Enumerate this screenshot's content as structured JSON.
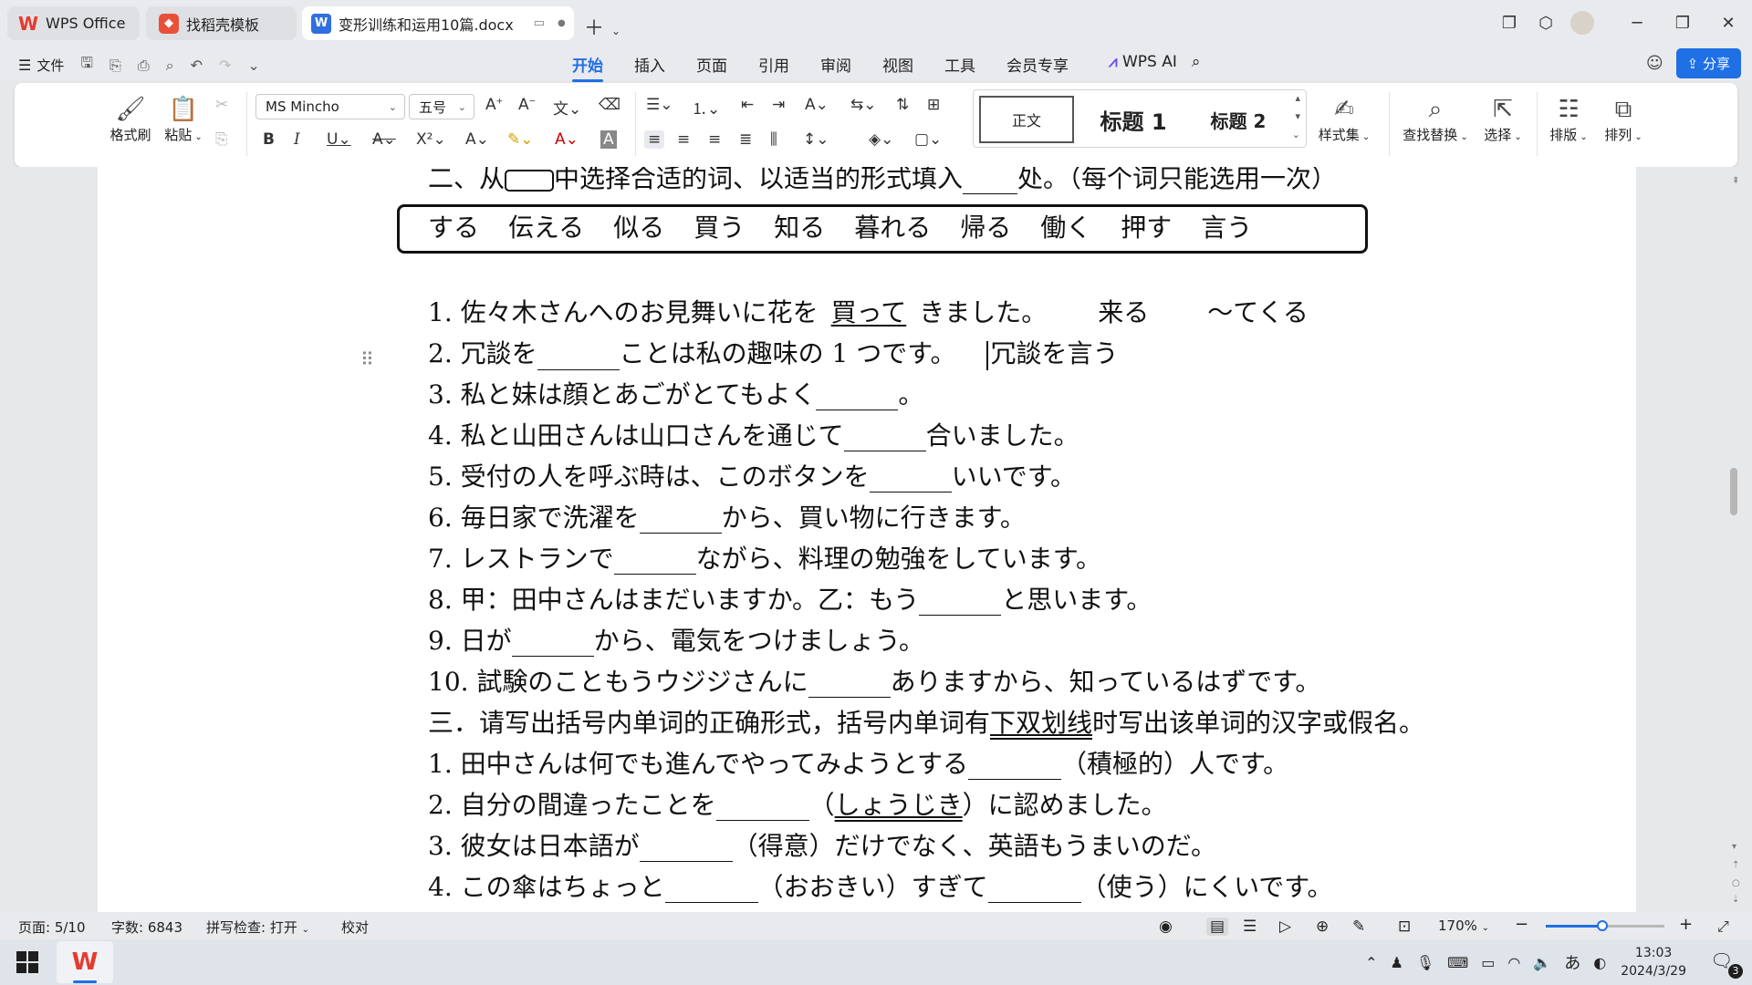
{
  "tabs": [
    {
      "label": "WPS Office",
      "icon": "wps-logo-icon"
    },
    {
      "label": "找稻壳模板",
      "icon": "docer-icon"
    },
    {
      "label": "变形训练和运用10篇.docx",
      "icon": "word-doc-icon"
    }
  ],
  "menu": {
    "file": "文件",
    "tabs": [
      "开始",
      "插入",
      "页面",
      "引用",
      "审阅",
      "视图",
      "工具",
      "会员专享"
    ],
    "wps_ai": "WPS AI",
    "share": "分享"
  },
  "ribbon": {
    "format_painter": "格式刷",
    "paste": "粘贴",
    "font_name": "MS Mincho",
    "font_size": "五号",
    "styles": {
      "normal": "正文",
      "heading1": "标题 1",
      "heading2": "标题 2"
    },
    "style_set": "样式集",
    "find_replace": "查找替换",
    "select": "选择",
    "layout": "排版",
    "arrange": "排列"
  },
  "document": {
    "section2_title_a": "二、从",
    "section2_title_b": "中选择合适的词、以适当的形式填入",
    "section2_title_c": "处。（每个词只能选用一次）",
    "word_bank": [
      "する",
      "伝える",
      "似る",
      "買う",
      "知る",
      "暮れる",
      "帰る",
      "働く",
      "押す",
      "言う"
    ],
    "q1a": "1. 佐々木さんへのお見舞いに花を",
    "q1b": "買って",
    "q1c": "きました。",
    "q1note1": "来る",
    "q1note2": "～てくる",
    "q2a": "2. 冗談を",
    "q2b": "ことは私の趣味の 1 つです。",
    "q2note": "冗談を言う",
    "q3a": "3. 私と妹は顔とあごがとてもよく",
    "q3b": "。",
    "q4a": "4. 私と山田さんは山口さんを通じて",
    "q4b": "合いました。",
    "q5a": "5. 受付の人を呼ぶ時は、このボタンを",
    "q5b": "いいです。",
    "q6a": "6. 毎日家で洗濯を",
    "q6b": "から、買い物に行きます。",
    "q7a": "7. レストランで",
    "q7b": "ながら、料理の勉強をしています。",
    "q8a": "8. 甲：田中さんはまだいますか。乙：もう",
    "q8b": "と思います。",
    "q9a": "9. 日が",
    "q9b": "から、電気をつけましょう。",
    "q10a": "10. 試験のこともうウジジさんに",
    "q10b": "ありますから、知っているはずです。",
    "s3a": "三．请写出括号内单词的正确形式，括号内单词有",
    "s3b": "下双划线",
    "s3c": "时写出该单词的汉字或假名。",
    "p1a": "1. 田中さんは何でも進んでやってみようとする",
    "p1b": "（積極的）人です。",
    "p2a": "2. 自分の間違ったことを",
    "p2b": "（",
    "p2c": "しょうじき",
    "p2d": "）に認めました。",
    "p3a": "3. 彼女は日本語が",
    "p3b": "（得意）だけでなく、英語もうまいのだ。",
    "p4a": "4. この傘はちょっと",
    "p4b": "（おおきい）すぎて",
    "p4c": "（使う）にくいです。"
  },
  "status": {
    "page": "页面: 5/10",
    "words": "字数: 6843",
    "spell": "拼写检查: 打开",
    "proof": "校对",
    "zoom": "170%",
    "zoom_slider_fraction": 0.48
  },
  "taskbar": {
    "time": "13:03",
    "date": "2024/3/29",
    "ime": "あ",
    "notifications": "3"
  },
  "colors": {
    "accent": "#1f6fe5",
    "wps_red": "#e43b2f"
  }
}
